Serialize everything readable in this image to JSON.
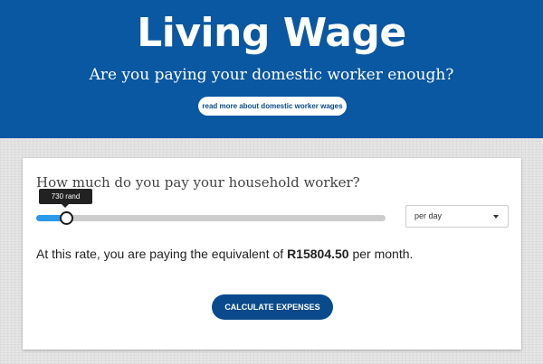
{
  "hero": {
    "title": "Living Wage",
    "subtitle": "Are you paying your domestic worker enough?",
    "read_more_label": "read more about domestic worker wages"
  },
  "form": {
    "question": "How much do you pay your household worker?",
    "slider": {
      "tooltip": "730 rand",
      "value_fraction": 0.085
    },
    "period_select": {
      "value": "per day"
    },
    "result": {
      "prefix": "At this rate, you are paying the equivalent of ",
      "amount": "R15804.50",
      "suffix": " per month."
    },
    "calculate_label": "CALCULATE EXPENSES"
  },
  "colors": {
    "brand_blue": "#0a57a2",
    "slider_fill": "#2a9ae8"
  }
}
